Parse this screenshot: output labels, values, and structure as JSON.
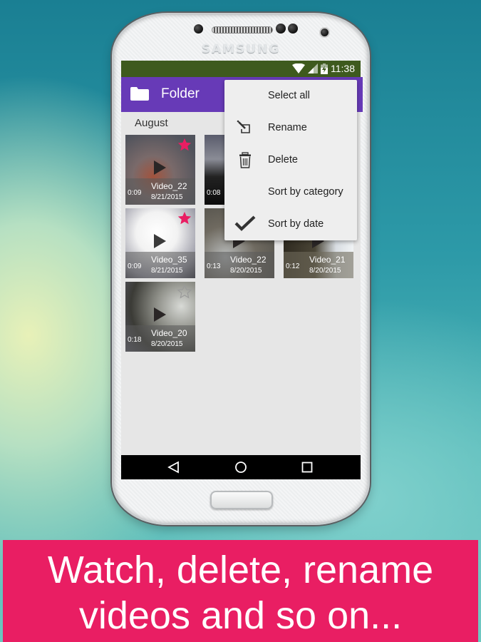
{
  "device": {
    "brand": "SAMSUNG"
  },
  "status_bar": {
    "time": "11:38",
    "icons": [
      "wifi-icon",
      "signal-icon",
      "battery-charging-icon"
    ],
    "color": "#3e5a1e"
  },
  "app_bar": {
    "icon": "folder-icon",
    "title": "Folder",
    "color": "#673ab7"
  },
  "section": {
    "label": "August"
  },
  "videos": [
    {
      "name": "Video_22",
      "date": "8/21/2015",
      "duration": "0:09",
      "favorite": true
    },
    {
      "name": "",
      "date": "",
      "duration": "0:08",
      "favorite": false
    },
    {
      "name": "Video_35",
      "date": "8/21/2015",
      "duration": "0:09",
      "favorite": true
    },
    {
      "name": "Video_22",
      "date": "8/20/2015",
      "duration": "0:13",
      "favorite": false
    },
    {
      "name": "Video_21",
      "date": "8/20/2015",
      "duration": "0:12",
      "favorite": false
    },
    {
      "name": "Video_20",
      "date": "8/20/2015",
      "duration": "0:18",
      "favorite": false
    }
  ],
  "menu": {
    "items": [
      {
        "label": "Select all",
        "icon": ""
      },
      {
        "label": "Rename",
        "icon": "rename-icon"
      },
      {
        "label": "Delete",
        "icon": "trash-icon"
      },
      {
        "label": "Sort by category",
        "icon": ""
      },
      {
        "label": "Sort by date",
        "icon": "checkmark-icon",
        "checked": true
      }
    ]
  },
  "nav_bar": {
    "buttons": [
      "back-icon",
      "home-icon",
      "recents-icon"
    ]
  },
  "banner": {
    "line1": "Watch, delete, rename",
    "line2": "videos and so on...",
    "color": "#e91e63"
  },
  "colors": {
    "favorite_star": "#e91e63"
  }
}
